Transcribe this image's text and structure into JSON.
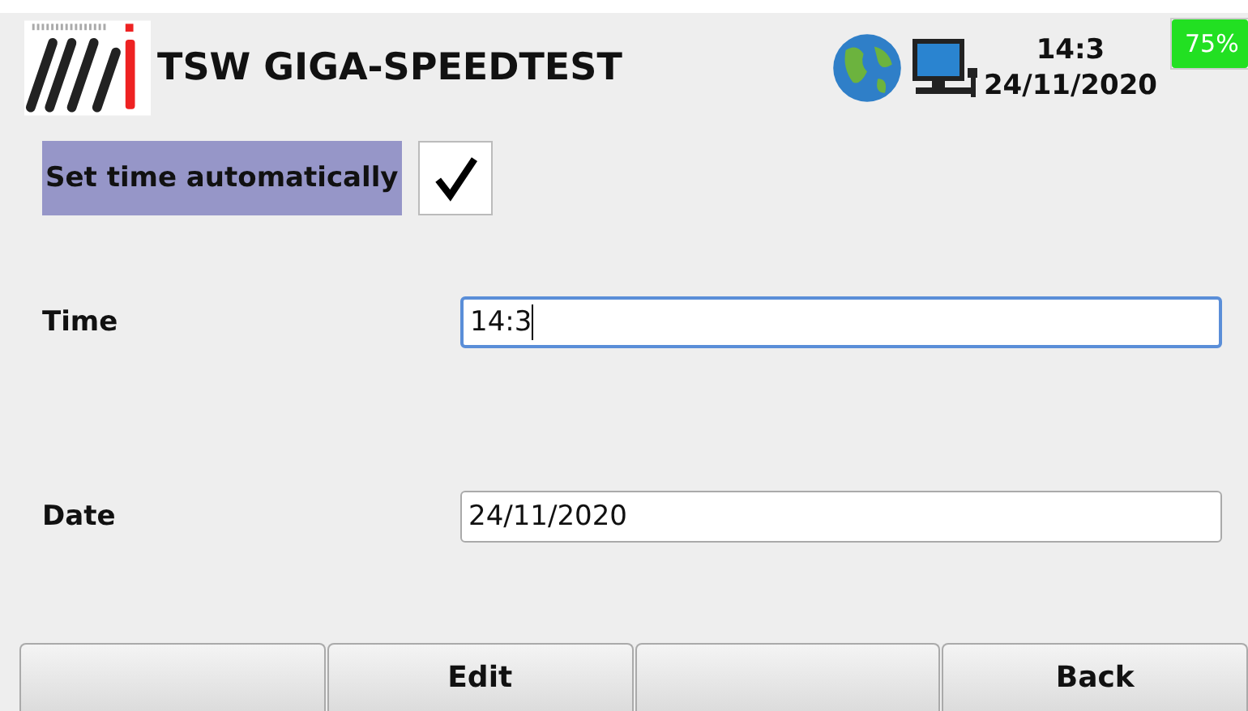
{
  "header": {
    "title": "TSW GIGA-SPEEDTEST",
    "time": "14:3",
    "date": "24/11/2020",
    "battery": {
      "label": "75%",
      "level": 0.75
    }
  },
  "auto_time": {
    "label": "Set time automatically",
    "checked": true
  },
  "fields": [
    {
      "label": "Time",
      "value": "14:3",
      "focused": true
    },
    {
      "label": "Date",
      "value": "24/11/2020",
      "focused": false
    }
  ],
  "buttons": [
    {
      "kind": "blank"
    },
    {
      "kind": "text",
      "label": "Edit"
    },
    {
      "kind": "blank"
    },
    {
      "kind": "text",
      "label": "Back"
    }
  ]
}
